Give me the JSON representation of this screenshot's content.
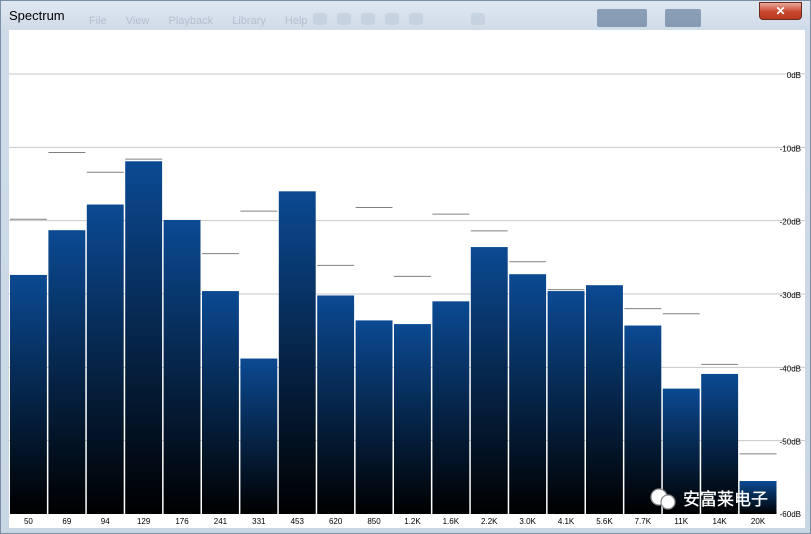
{
  "window": {
    "title": "Spectrum",
    "background_menu": [
      "File",
      "View",
      "Playback",
      "Library",
      "Help"
    ]
  },
  "close_label": "✕",
  "watermark": {
    "text": "安富莱电子",
    "icon": "wechat-icon"
  },
  "colors": {
    "bar_top": "#0b4a93",
    "bar_bottom": "#000000",
    "grid": "#c8c8c8",
    "peak": "#808080",
    "background": "#ffffff"
  },
  "chart_data": {
    "type": "bar",
    "categories": [
      "50",
      "69",
      "94",
      "129",
      "176",
      "241",
      "331",
      "453",
      "620",
      "850",
      "1.2K",
      "1.6K",
      "2.2K",
      "3.0K",
      "4.1K",
      "5.6K",
      "7.7K",
      "11K",
      "14K",
      "20K"
    ],
    "series": [
      {
        "values": [
          -27.4,
          -21.3,
          -17.8,
          -11.9,
          -19.9,
          -29.6,
          -38.8,
          -16.0,
          -30.2,
          -33.6,
          -34.1,
          -31.0,
          -23.6,
          -27.3,
          -29.6,
          -28.8,
          -34.3,
          -42.9,
          -40.9,
          -55.5
        ]
      }
    ],
    "peaks": [
      -19.8,
      -10.7,
      -13.4,
      -11.6,
      null,
      -24.5,
      -18.7,
      null,
      -26.1,
      -18.2,
      -27.6,
      -19.1,
      -21.4,
      -25.6,
      -29.4,
      null,
      -32.0,
      -32.7,
      -39.6,
      -51.8
    ],
    "y_ticks": [
      "0dB",
      "-10dB",
      "-20dB",
      "-30dB",
      "-40dB",
      "-50dB",
      "-60dB"
    ],
    "y_tick_values": [
      0,
      -10,
      -20,
      -30,
      -40,
      -50,
      -60
    ],
    "ylim": [
      -60,
      6
    ],
    "grid": true
  }
}
